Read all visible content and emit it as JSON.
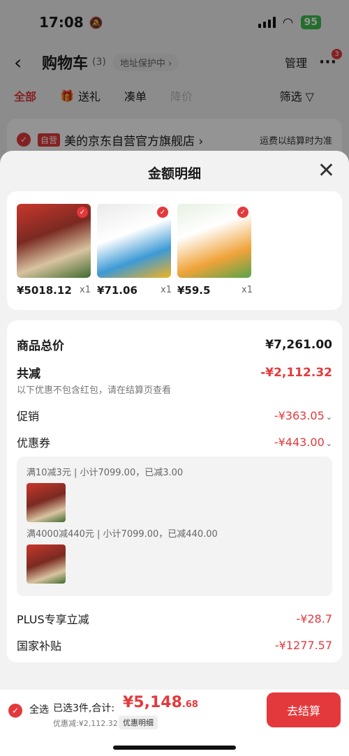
{
  "status": {
    "time": "17:08",
    "battery": "95"
  },
  "nav": {
    "back": "‹",
    "title": "购物车",
    "count": "(3)",
    "protect": "地址保护中 ›",
    "manage": "管理",
    "more": "···",
    "badge": "3"
  },
  "filters": {
    "all": "全部",
    "gift": "送礼",
    "combo": "凑单",
    "price_drop": "降价",
    "filter": "筛选 ▽"
  },
  "store": {
    "tag": "自营",
    "name": "美的京东自营官方旗舰店 ›",
    "shipping": "运费以结算时为准"
  },
  "sheet": {
    "title": "金额明细",
    "close": "✕"
  },
  "products": [
    {
      "price": "¥5018.12",
      "qty": "x1"
    },
    {
      "price": "¥71.06",
      "qty": "x1"
    },
    {
      "price": "¥59.5",
      "qty": "x1"
    }
  ],
  "details": {
    "total_label": "商品总价",
    "total_value": "¥7,261.00",
    "discount_label": "共减",
    "discount_value": "-¥2,112.32",
    "discount_note": "以下优惠不包含红包，请在结算页查看",
    "promo_label": "促销",
    "promo_value": "-¥363.05",
    "coupon_label": "优惠券",
    "coupon_value": "-¥443.00",
    "coupon_line_1": "满10减3元 | 小计7099.00，已减3.00",
    "coupon_line_2": "满4000减440元 | 小计7099.00，已减440.00",
    "plus_label": "PLUS专享立减",
    "plus_value": "-¥28.7",
    "subsidy_label": "国家补贴",
    "subsidy_value": "-¥1277.57"
  },
  "bottom": {
    "select_all": "全选",
    "selected": "已选3件,合计:",
    "total_main": "¥5,148",
    "total_decimal": ".68",
    "discount": "优惠减:¥2,112.32",
    "detail_btn": "优惠明细",
    "pay": "去结算"
  }
}
